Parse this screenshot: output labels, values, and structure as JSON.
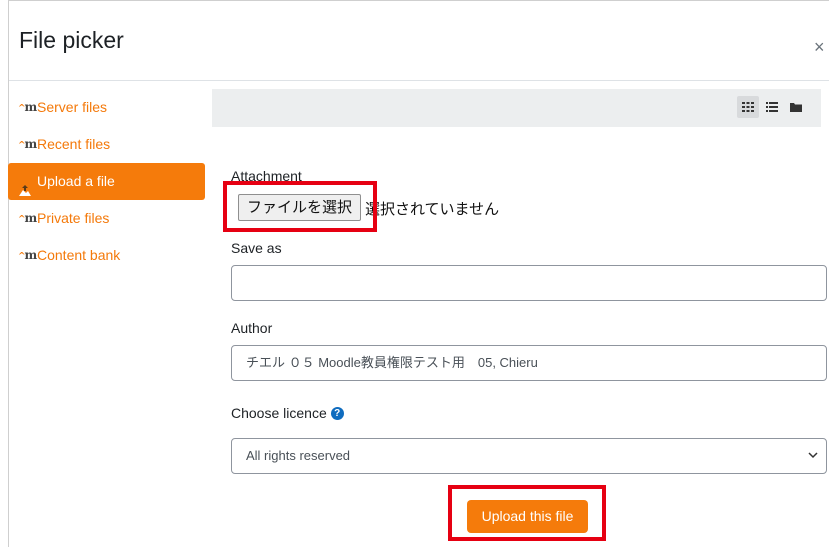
{
  "dialog": {
    "title": "File picker",
    "close_glyph": "×"
  },
  "sidebar": {
    "items": [
      {
        "label": "Server files",
        "icon": "moodle-icon",
        "active": false
      },
      {
        "label": "Recent files",
        "icon": "moodle-icon",
        "active": false
      },
      {
        "label": "Upload a file",
        "icon": "upload-icon",
        "active": true
      },
      {
        "label": "Private files",
        "icon": "moodle-icon",
        "active": false
      },
      {
        "label": "Content bank",
        "icon": "moodle-icon",
        "active": false
      }
    ]
  },
  "toolbar": {
    "view_buttons": [
      "grid-view-icon",
      "list-view-icon",
      "folder-view-icon"
    ]
  },
  "form": {
    "attachment_label": "Attachment",
    "file_button_label": "ファイルを選択",
    "file_status": "選択されていません",
    "save_as_label": "Save as",
    "save_as_value": "",
    "author_label": "Author",
    "author_value": "チエル ０５ Moodle教員権限テスト用　05, Chieru",
    "licence_label": "Choose licence",
    "licence_value": "All rights reserved",
    "upload_button_label": "Upload this file"
  },
  "colors": {
    "accent": "#f57b0b",
    "highlight": "#e60012",
    "help": "#0f6cbf"
  }
}
